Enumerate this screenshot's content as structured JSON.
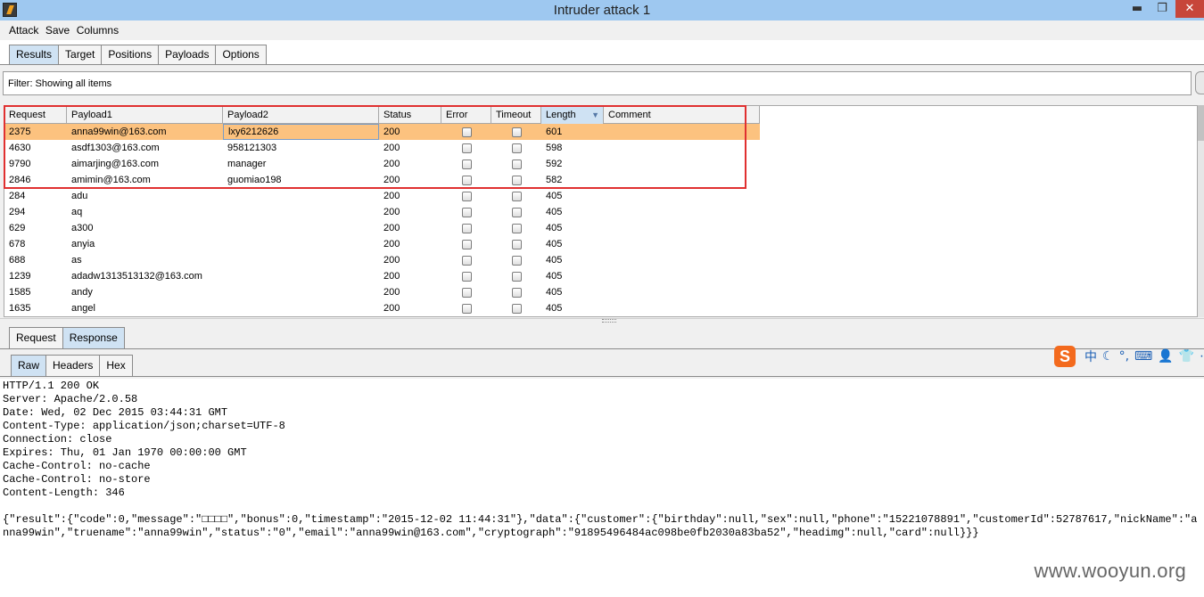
{
  "window": {
    "title": "Intruder attack 1",
    "minimize": "▬",
    "maximize": "❐",
    "close": "✕"
  },
  "menu": [
    "Attack",
    "Save",
    "Columns"
  ],
  "tabs": [
    "Results",
    "Target",
    "Positions",
    "Payloads",
    "Options"
  ],
  "filter_text": "Filter:  Showing all items",
  "table": {
    "columns": [
      "Request",
      "Payload1",
      "Payload2",
      "Status",
      "Error",
      "Timeout",
      "Length",
      "Comment"
    ],
    "sorted_column": "Length",
    "sort_arrow": "▼",
    "rows": [
      {
        "request": "2375",
        "payload1": "anna99win@163.com",
        "payload2": "lxy6212626",
        "status": "200",
        "length": "601"
      },
      {
        "request": "4630",
        "payload1": "asdf1303@163.com",
        "payload2": "958121303",
        "status": "200",
        "length": "598"
      },
      {
        "request": "9790",
        "payload1": "aimarjing@163.com",
        "payload2": "manager",
        "status": "200",
        "length": "592"
      },
      {
        "request": "2846",
        "payload1": "amimin@163.com",
        "payload2": "guomiao198",
        "status": "200",
        "length": "582"
      },
      {
        "request": "284",
        "payload1": "adu",
        "payload2": "",
        "status": "200",
        "length": "405"
      },
      {
        "request": "294",
        "payload1": "aq",
        "payload2": "",
        "status": "200",
        "length": "405"
      },
      {
        "request": "629",
        "payload1": "a300",
        "payload2": "",
        "status": "200",
        "length": "405"
      },
      {
        "request": "678",
        "payload1": "anyia",
        "payload2": "",
        "status": "200",
        "length": "405"
      },
      {
        "request": "688",
        "payload1": "as",
        "payload2": "",
        "status": "200",
        "length": "405"
      },
      {
        "request": "1239",
        "payload1": "adadw1313513132@163.com",
        "payload2": "",
        "status": "200",
        "length": "405"
      },
      {
        "request": "1585",
        "payload1": "andy",
        "payload2": "",
        "status": "200",
        "length": "405"
      },
      {
        "request": "1635",
        "payload1": "angel",
        "payload2": "",
        "status": "200",
        "length": "405"
      }
    ]
  },
  "message_tabs": [
    "Request",
    "Response"
  ],
  "view_tabs": [
    "Raw",
    "Headers",
    "Hex"
  ],
  "ime": {
    "logo": "S",
    "items": [
      "中",
      "☾",
      "°,",
      "⌨",
      "👤",
      "👕",
      "⋯"
    ]
  },
  "response": {
    "headers": [
      "HTTP/1.1 200 OK",
      "Server: Apache/2.0.58",
      "Date: Wed, 02 Dec 2015 03:44:31 GMT",
      "Content-Type: application/json;charset=UTF-8",
      "Connection: close",
      "Expires: Thu, 01 Jan 1970 00:00:00 GMT",
      "Cache-Control: no-cache",
      "Cache-Control: no-store",
      "Content-Length: 346"
    ],
    "body": "{\"result\":{\"code\":0,\"message\":\"□□□□\",\"bonus\":0,\"timestamp\":\"2015-12-02 11:44:31\"},\"data\":{\"customer\":{\"birthday\":null,\"sex\":null,\"phone\":\"15221078891\",\"customerId\":52787617,\"nickName\":\"anna99win\",\"truename\":\"anna99win\",\"status\":\"0\",\"email\":\"anna99win@163.com\",\"cryptograph\":\"91895496484ac098be0fb2030a83ba52\",\"headimg\":null,\"card\":null}}}"
  },
  "watermark": "www.wooyun.org"
}
